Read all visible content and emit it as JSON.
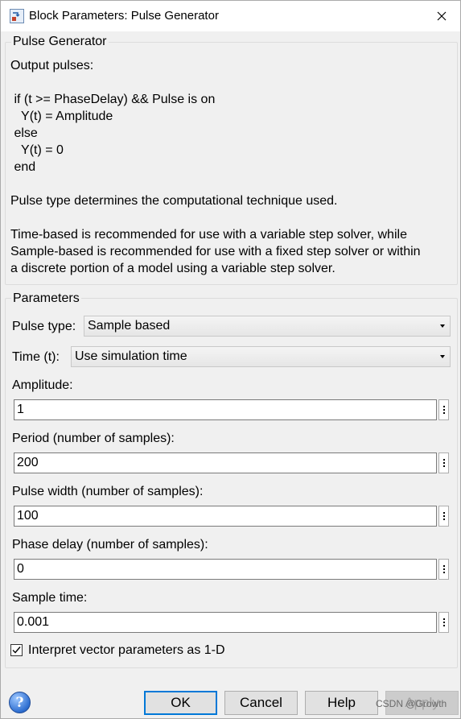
{
  "window": {
    "title": "Block Parameters: Pulse Generator",
    "close_glyph": "✕"
  },
  "description": {
    "group_title": "Pulse Generator",
    "lines": [
      "Output pulses:",
      " if (t >= PhaseDelay) && Pulse is on",
      "   Y(t) = Amplitude",
      " else",
      "   Y(t) = 0",
      " end",
      "Pulse type determines the computational technique used.",
      "Time-based is recommended for use with a variable step solver, while",
      "Sample-based is recommended for use with a fixed step solver or within",
      "a discrete portion of a model using a variable step solver."
    ]
  },
  "parameters": {
    "group_title": "Parameters",
    "pulse_type_label": "Pulse type:",
    "pulse_type_value": "Sample based",
    "time_label": "Time (t):",
    "time_value": "Use simulation time",
    "amplitude_label": "Amplitude:",
    "amplitude_value": "1",
    "period_label": "Period (number of samples):",
    "period_value": "200",
    "pulse_width_label": "Pulse width (number of samples):",
    "pulse_width_value": "100",
    "phase_delay_label": "Phase delay (number of samples):",
    "phase_delay_value": "0",
    "sample_time_label": "Sample time:",
    "sample_time_value": "0.001",
    "interpret_label": "Interpret vector parameters as 1-D",
    "interpret_checked": true
  },
  "buttons": {
    "ok": "OK",
    "cancel": "Cancel",
    "help": "Help",
    "apply": "Apply",
    "help_icon_glyph": "?"
  },
  "watermark": "CSDN @Growth"
}
